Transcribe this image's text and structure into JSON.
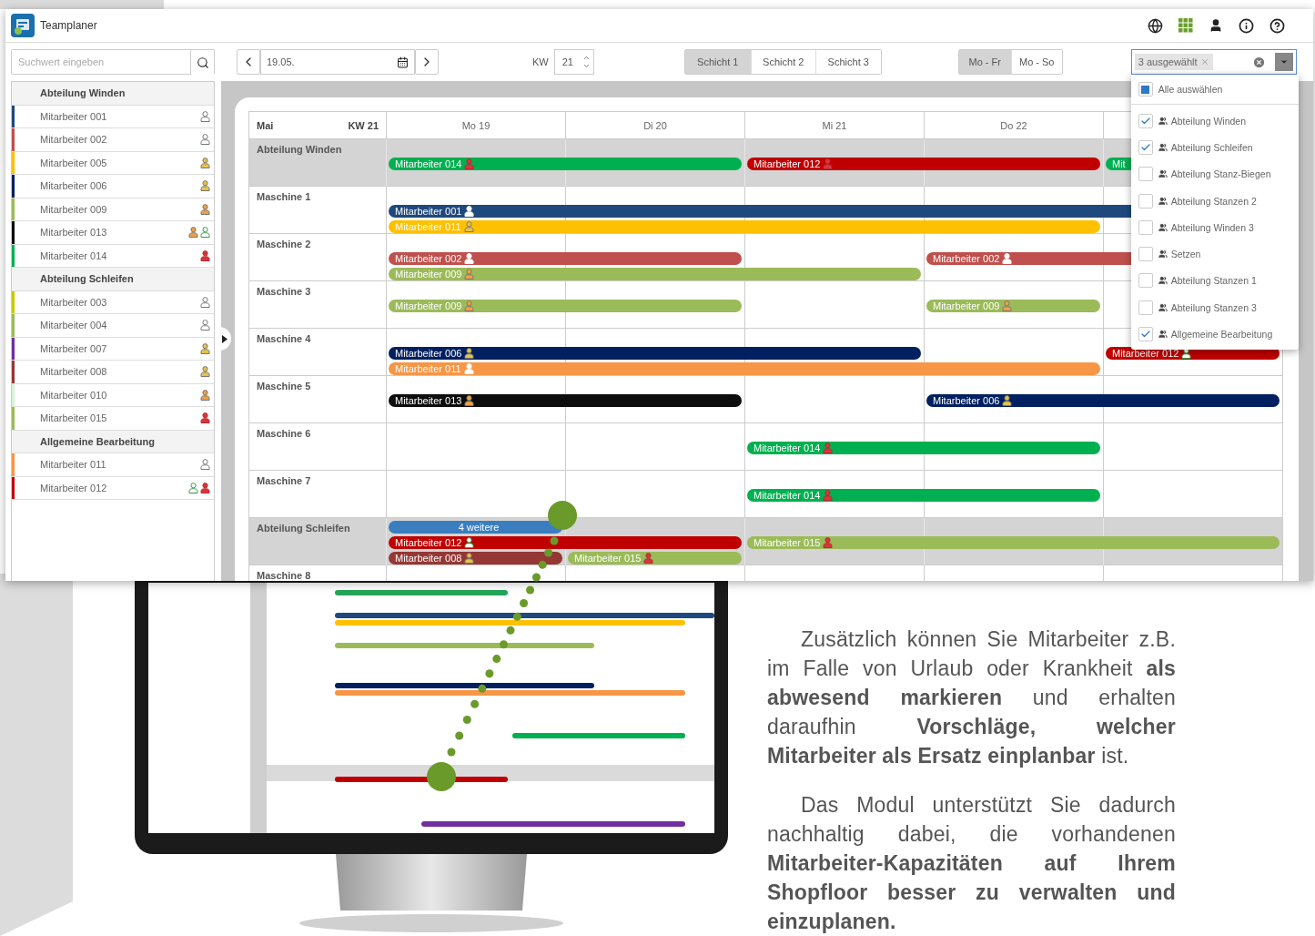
{
  "app": {
    "title": "Teamplaner"
  },
  "toolbar": {
    "search": {
      "placeholder": "Suchwert eingeben"
    },
    "date": {
      "value": "19.05."
    },
    "week": {
      "label": "KW",
      "value": "21"
    },
    "shifts": [
      {
        "label": "Schicht 1",
        "selected": true
      },
      {
        "label": "Schicht 2",
        "selected": false
      },
      {
        "label": "Schicht 3",
        "selected": false
      }
    ],
    "day_ranges": [
      {
        "label": "Mo - Fr",
        "selected": true
      },
      {
        "label": "Mo - So",
        "selected": false
      }
    ],
    "filter": {
      "chip": "3 ausgewählt"
    }
  },
  "filter_dropdown": {
    "select_all": {
      "label": "Alle auswählen",
      "checked": false,
      "indeterminate": true
    },
    "items": [
      {
        "label": "Abteilung Winden",
        "checked": true
      },
      {
        "label": "Abteilung Schleifen",
        "checked": true
      },
      {
        "label": "Abteilung Stanz-Biegen",
        "checked": false
      },
      {
        "label": "Abteilung Stanzen 2",
        "checked": false
      },
      {
        "label": "Abteilung Winden 3",
        "checked": false
      },
      {
        "label": "Setzen",
        "checked": false
      },
      {
        "label": "Abteilung Stanzen 1",
        "checked": false
      },
      {
        "label": "Abteilung Stanzen 3",
        "checked": false
      },
      {
        "label": "Allgemeine Bearbeitung",
        "checked": true
      }
    ]
  },
  "sidebar": {
    "groups": [
      {
        "title": "Abteilung Winden",
        "employees": [
          {
            "name": "Mitarbeiter 001",
            "color": "#1f497d",
            "icons": [
              {
                "kind": "none"
              }
            ]
          },
          {
            "name": "Mitarbeiter 002",
            "color": "#c0504d",
            "icons": [
              {
                "kind": "none"
              }
            ]
          },
          {
            "name": "Mitarbeiter 005",
            "color": "#ffc000",
            "icons": [
              {
                "kind": "yellow"
              }
            ]
          },
          {
            "name": "Mitarbeiter 006",
            "color": "#002060",
            "icons": [
              {
                "kind": "yellow"
              }
            ]
          },
          {
            "name": "Mitarbeiter 009",
            "color": "#9bbb59",
            "icons": [
              {
                "kind": "orange"
              }
            ]
          },
          {
            "name": "Mitarbeiter 013",
            "color": "#0d0d0d",
            "icons": [
              {
                "kind": "orange"
              },
              {
                "kind": "green"
              }
            ]
          },
          {
            "name": "Mitarbeiter 014",
            "color": "#00b050",
            "icons": [
              {
                "kind": "red"
              }
            ]
          }
        ]
      },
      {
        "title": "Abteilung Schleifen",
        "employees": [
          {
            "name": "Mitarbeiter 003",
            "color": "#c9c900",
            "icons": [
              {
                "kind": "none"
              }
            ]
          },
          {
            "name": "Mitarbeiter 004",
            "color": "#9bbb59",
            "icons": [
              {
                "kind": "none"
              }
            ]
          },
          {
            "name": "Mitarbeiter 007",
            "color": "#7030a0",
            "icons": [
              {
                "kind": "yellow"
              }
            ]
          },
          {
            "name": "Mitarbeiter 008",
            "color": "#953735",
            "icons": [
              {
                "kind": "yellow"
              }
            ]
          },
          {
            "name": "Mitarbeiter 010",
            "color": "#d6f5d6",
            "icons": [
              {
                "kind": "orange"
              }
            ]
          },
          {
            "name": "Mitarbeiter 015",
            "color": "#9bbb59",
            "icons": [
              {
                "kind": "red"
              }
            ]
          }
        ]
      },
      {
        "title": "Allgemeine Bearbeitung",
        "employees": [
          {
            "name": "Mitarbeiter 011",
            "color": "#f79646",
            "icons": [
              {
                "kind": "none"
              }
            ]
          },
          {
            "name": "Mitarbeiter 012",
            "color": "#c00000",
            "icons": [
              {
                "kind": "green"
              },
              {
                "kind": "red"
              }
            ]
          }
        ]
      }
    ]
  },
  "schedule": {
    "month": "Mai",
    "week": "KW 21",
    "days": [
      "Mo 19",
      "Di 20",
      "Mi 21",
      "Do 22"
    ],
    "rows": [
      {
        "label": "Abteilung Winden",
        "kind": "department",
        "lanes": {
          "middle": [
            {
              "kind": "shift",
              "label": "Mitarbeiter 014",
              "color": "#00b050",
              "icon": {
                "kind": "red"
              }
            },
            {
              "kind": "continued"
            },
            {
              "kind": "shift",
              "label": "Mitarbeiter 012",
              "color": "#c00000",
              "icon": {
                "kind": "red"
              }
            },
            {
              "kind": "continued"
            },
            {
              "kind": "shift",
              "label": "Mit",
              "color": "#00b050"
            }
          ]
        }
      },
      {
        "label": "Maschine 1",
        "kind": "machine",
        "lanes": {
          "middle": [
            {
              "kind": "shift",
              "label": "Mitarbeiter 001",
              "color": "#1f497d",
              "icon": {
                "kind": "white"
              }
            },
            {
              "kind": "continued"
            },
            {
              "kind": "continued"
            },
            {
              "kind": "continued"
            },
            {
              "kind": "continued"
            }
          ],
          "bottom": [
            {
              "kind": "shift",
              "label": "Mitarbeiter 011",
              "color": "#ffc000",
              "icon": {
                "kind": "yellow"
              }
            },
            {
              "kind": "continued"
            },
            {
              "kind": "continued"
            },
            {
              "kind": "continued"
            }
          ]
        }
      },
      {
        "label": "Maschine 2",
        "kind": "machine",
        "lanes": {
          "middle": [
            {
              "kind": "shift",
              "label": "Mitarbeiter 002",
              "color": "#c0504d",
              "icon": {
                "kind": "white"
              }
            },
            {
              "kind": "continued"
            },
            {
              "kind": "empty"
            },
            {
              "kind": "shift",
              "label": "Mitarbeiter 002",
              "color": "#c0504d",
              "icon": {
                "kind": "white"
              }
            },
            {
              "kind": "continued"
            }
          ],
          "bottom": [
            {
              "kind": "shift",
              "label": "Mitarbeiter 009",
              "color": "#9bbb59",
              "icon": {
                "kind": "orange"
              }
            },
            {
              "kind": "continued"
            },
            {
              "kind": "continued"
            }
          ]
        }
      },
      {
        "label": "Maschine 3",
        "kind": "machine",
        "lanes": {
          "middle": [
            {
              "kind": "shift",
              "label": "Mitarbeiter 009",
              "color": "#9bbb59",
              "icon": {
                "kind": "orange"
              }
            },
            {
              "kind": "continued"
            },
            {
              "kind": "empty"
            },
            {
              "kind": "shift",
              "label": "Mitarbeiter 009",
              "color": "#9bbb59",
              "icon": {
                "kind": "orange"
              }
            }
          ]
        }
      },
      {
        "label": "Maschine 4",
        "kind": "machine",
        "lanes": {
          "middle": [
            {
              "kind": "shift",
              "label": "Mitarbeiter 006",
              "color": "#002060",
              "icon": {
                "kind": "yellow"
              }
            },
            {
              "kind": "continued"
            },
            {
              "kind": "continued"
            },
            {
              "kind": "empty"
            },
            {
              "kind": "shift",
              "label": "Mitarbeiter 012",
              "color": "#c00000",
              "icon": {
                "kind": "green"
              }
            }
          ],
          "bottom": [
            {
              "kind": "shift",
              "label": "Mitarbeiter 011",
              "color": "#f79646",
              "icon": {
                "kind": "white"
              }
            },
            {
              "kind": "continued"
            },
            {
              "kind": "continued"
            },
            {
              "kind": "continued"
            }
          ]
        }
      },
      {
        "label": "Maschine 5",
        "kind": "machine",
        "lanes": {
          "middle": [
            {
              "kind": "shift",
              "label": "Mitarbeiter 013",
              "color": "#0d0d0d",
              "icon": {
                "kind": "orange"
              }
            },
            {
              "kind": "continued"
            },
            {
              "kind": "empty"
            },
            {
              "kind": "shift",
              "label": "Mitarbeiter 006",
              "color": "#002060",
              "icon": {
                "kind": "yellow"
              }
            },
            {
              "kind": "continued"
            }
          ]
        }
      },
      {
        "label": "Maschine 6",
        "kind": "machine",
        "lanes": {
          "middle": [
            {
              "kind": "empty"
            },
            {
              "kind": "empty"
            },
            {
              "kind": "shift",
              "label": "Mitarbeiter 014",
              "color": "#00b050",
              "icon": {
                "kind": "red"
              }
            },
            {
              "kind": "continued"
            }
          ]
        }
      },
      {
        "label": "Maschine 7",
        "kind": "machine",
        "lanes": {
          "middle": [
            {
              "kind": "empty"
            },
            {
              "kind": "empty"
            },
            {
              "kind": "shift",
              "label": "Mitarbeiter 014",
              "color": "#00b050",
              "icon": {
                "kind": "red"
              }
            },
            {
              "kind": "continued"
            }
          ]
        }
      },
      {
        "label": "Abteilung Schleifen",
        "kind": "department",
        "lanes": {
          "top": [
            {
              "kind": "more",
              "label": "4 weitere",
              "color": "#3a7ebf"
            }
          ],
          "middle": [
            {
              "kind": "shift",
              "label": "Mitarbeiter 012",
              "color": "#c00000",
              "icon": {
                "kind": "green"
              }
            },
            {
              "kind": "continued"
            },
            {
              "kind": "shift",
              "label": "Mitarbeiter 015",
              "color": "#9bbb59",
              "icon": {
                "kind": "red"
              }
            },
            {
              "kind": "continued"
            },
            {
              "kind": "continued"
            }
          ],
          "bottom": [
            {
              "kind": "shift",
              "label": "Mitarbeiter 008",
              "color": "#953735",
              "icon": {
                "kind": "yellow"
              }
            },
            {
              "kind": "shift",
              "label": "Mitarbeiter 015",
              "color": "#9bbb59",
              "icon": {
                "kind": "red"
              }
            }
          ]
        }
      },
      {
        "label": "Maschine 8",
        "kind": "machine"
      }
    ]
  },
  "description": {
    "paragraphs": [
      "Zusätzlich können Sie Mitarbeiter z.B. im Falle von Urlaub oder Krankheit **als abwesend markieren** und erhalten daraufhin **Vorschläge, welcher Mitarbeiter als Ersatz einplanbar** ist.",
      "Das Modul unterstützt Sie dadurch nachhaltig dabei, die vorhandenen **Mitarbeiter-Kapazitäten auf Ihrem Shopfloor besser zu verwalten und einzuplanen.**"
    ]
  }
}
